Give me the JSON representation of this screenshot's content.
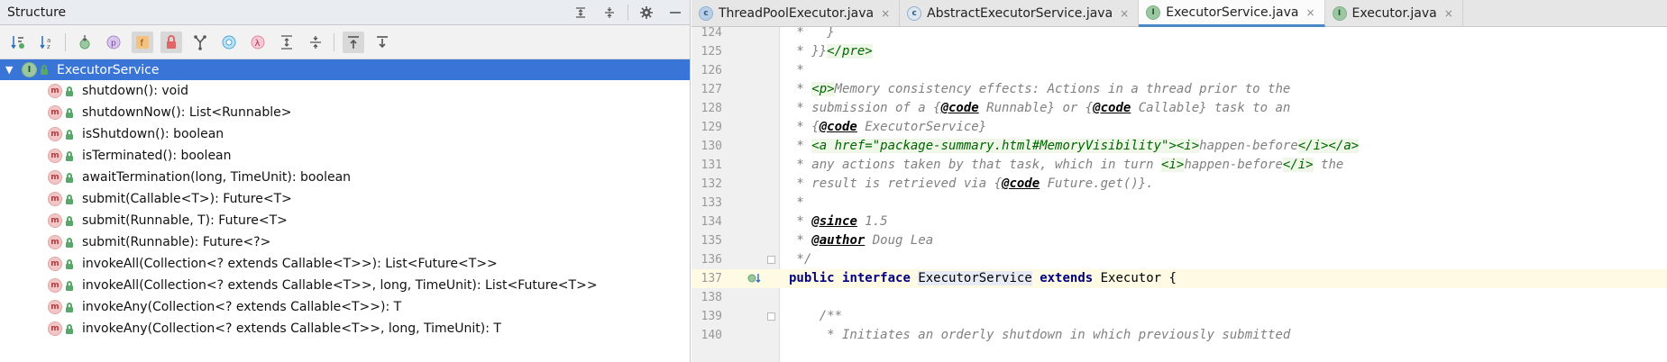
{
  "structure": {
    "title": "Structure",
    "root": "ExecutorService",
    "items": [
      {
        "label": "shutdown(): void"
      },
      {
        "label": "shutdownNow(): List<Runnable>"
      },
      {
        "label": "isShutdown(): boolean"
      },
      {
        "label": "isTerminated(): boolean"
      },
      {
        "label": "awaitTermination(long, TimeUnit): boolean"
      },
      {
        "label": "submit(Callable<T>): Future<T>"
      },
      {
        "label": "submit(Runnable, T): Future<T>"
      },
      {
        "label": "submit(Runnable): Future<?>"
      },
      {
        "label": "invokeAll(Collection<? extends Callable<T>>): List<Future<T>>"
      },
      {
        "label": "invokeAll(Collection<? extends Callable<T>>, long, TimeUnit): List<Future<T>>"
      },
      {
        "label": "invokeAny(Collection<? extends Callable<T>>): T"
      },
      {
        "label": "invokeAny(Collection<? extends Callable<T>>, long, TimeUnit): T"
      }
    ],
    "toolbar_icons": [
      "sort-by-visibility-icon",
      "sort-alphabetically-icon",
      "show-inherited-icon",
      "show-properties-icon",
      "show-fields-icon",
      "show-non-public-icon",
      "show-lambdas-icon",
      "show-anonymous-icon",
      "show-lambda-icon",
      "expand-all-icon",
      "collapse-all-icon",
      "autoscroll-to-source-icon",
      "autoscroll-from-source-icon"
    ],
    "icon_letters": {
      "method": "m",
      "interface": "I",
      "properties": "p",
      "fields": "f",
      "lambda": "λ"
    }
  },
  "editor": {
    "tabs": [
      {
        "label": "ThreadPoolExecutor.java",
        "icon": "c",
        "active": false
      },
      {
        "label": "AbstractExecutorService.java",
        "icon": "c",
        "active": false
      },
      {
        "label": "ExecutorService.java",
        "icon": "I",
        "active": true
      },
      {
        "label": "Executor.java",
        "icon": "I",
        "active": false
      }
    ],
    "close_glyph": "×",
    "lines": [
      {
        "num": "124",
        "text": " *   }"
      },
      {
        "num": "125",
        "text": " * }}</pre>"
      },
      {
        "num": "126",
        "text": " *"
      },
      {
        "num": "127",
        "text": " * <p>Memory consistency effects: Actions in a thread prior to the"
      },
      {
        "num": "128",
        "text": " * submission of a {@code Runnable} or {@code Callable} task to an"
      },
      {
        "num": "129",
        "text": " * {@code ExecutorService}"
      },
      {
        "num": "130",
        "text": " * <a href=\"package-summary.html#MemoryVisibility\"><i>happen-before</i></a>"
      },
      {
        "num": "131",
        "text": " * any actions taken by that task, which in turn <i>happen-before</i> the"
      },
      {
        "num": "132",
        "text": " * result is retrieved via {@code Future.get()}."
      },
      {
        "num": "133",
        "text": " *"
      },
      {
        "num": "134",
        "text": " * @since 1.5"
      },
      {
        "num": "135",
        "text": " * @author Doug Lea"
      },
      {
        "num": "136",
        "text": " */"
      },
      {
        "num": "137",
        "text": "public interface ExecutorService extends Executor {"
      },
      {
        "num": "138",
        "text": ""
      },
      {
        "num": "139",
        "text": "    /**"
      },
      {
        "num": "140",
        "text": "     * Initiates an orderly shutdown in which previously submitted"
      }
    ]
  },
  "colors": {
    "selection": "#3875d7",
    "active_tab_underline": "#4a88c7",
    "current_line": "#fffae3"
  }
}
